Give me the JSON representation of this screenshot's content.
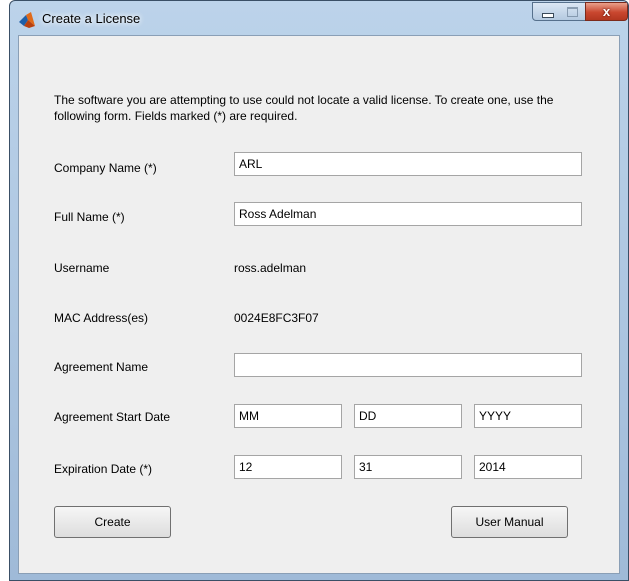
{
  "window": {
    "title": "Create a License",
    "close_glyph": "x",
    "icon": "matlab-icon"
  },
  "form": {
    "intro": "The software you are attempting to use could not locate a valid license.  To create one, use the following form.  Fields marked (*) are required.",
    "company_name": {
      "label": "Company Name (*)",
      "value": "ARL"
    },
    "full_name": {
      "label": "Full Name (*)",
      "value": "Ross Adelman"
    },
    "username": {
      "label": "Username",
      "value": "ross.adelman"
    },
    "mac_address": {
      "label": "MAC Address(es)",
      "value": "0024E8FC3F07"
    },
    "agreement_name": {
      "label": "Agreement Name",
      "value": ""
    },
    "agreement_start_date": {
      "label": "Agreement Start Date",
      "month_placeholder": "MM",
      "day_placeholder": "DD",
      "year_placeholder": "YYYY"
    },
    "expiration_date": {
      "label": "Expiration Date (*)",
      "month": "12",
      "day": "31",
      "year": "2014"
    }
  },
  "buttons": {
    "create": "Create",
    "user_manual": "User Manual"
  }
}
